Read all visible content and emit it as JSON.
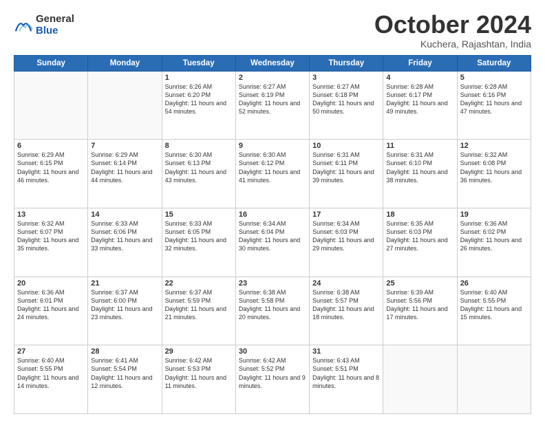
{
  "logo": {
    "general": "General",
    "blue": "Blue"
  },
  "header": {
    "month": "October 2024",
    "location": "Kuchera, Rajashtan, India"
  },
  "days": [
    "Sunday",
    "Monday",
    "Tuesday",
    "Wednesday",
    "Thursday",
    "Friday",
    "Saturday"
  ],
  "weeks": [
    [
      {
        "day": "",
        "content": ""
      },
      {
        "day": "",
        "content": ""
      },
      {
        "day": "1",
        "content": "Sunrise: 6:26 AM\nSunset: 6:20 PM\nDaylight: 11 hours and 54 minutes."
      },
      {
        "day": "2",
        "content": "Sunrise: 6:27 AM\nSunset: 6:19 PM\nDaylight: 11 hours and 52 minutes."
      },
      {
        "day": "3",
        "content": "Sunrise: 6:27 AM\nSunset: 6:18 PM\nDaylight: 11 hours and 50 minutes."
      },
      {
        "day": "4",
        "content": "Sunrise: 6:28 AM\nSunset: 6:17 PM\nDaylight: 11 hours and 49 minutes."
      },
      {
        "day": "5",
        "content": "Sunrise: 6:28 AM\nSunset: 6:16 PM\nDaylight: 11 hours and 47 minutes."
      }
    ],
    [
      {
        "day": "6",
        "content": "Sunrise: 6:29 AM\nSunset: 6:15 PM\nDaylight: 11 hours and 46 minutes."
      },
      {
        "day": "7",
        "content": "Sunrise: 6:29 AM\nSunset: 6:14 PM\nDaylight: 11 hours and 44 minutes."
      },
      {
        "day": "8",
        "content": "Sunrise: 6:30 AM\nSunset: 6:13 PM\nDaylight: 11 hours and 43 minutes."
      },
      {
        "day": "9",
        "content": "Sunrise: 6:30 AM\nSunset: 6:12 PM\nDaylight: 11 hours and 41 minutes."
      },
      {
        "day": "10",
        "content": "Sunrise: 6:31 AM\nSunset: 6:11 PM\nDaylight: 11 hours and 39 minutes."
      },
      {
        "day": "11",
        "content": "Sunrise: 6:31 AM\nSunset: 6:10 PM\nDaylight: 11 hours and 38 minutes."
      },
      {
        "day": "12",
        "content": "Sunrise: 6:32 AM\nSunset: 6:08 PM\nDaylight: 11 hours and 36 minutes."
      }
    ],
    [
      {
        "day": "13",
        "content": "Sunrise: 6:32 AM\nSunset: 6:07 PM\nDaylight: 11 hours and 35 minutes."
      },
      {
        "day": "14",
        "content": "Sunrise: 6:33 AM\nSunset: 6:06 PM\nDaylight: 11 hours and 33 minutes."
      },
      {
        "day": "15",
        "content": "Sunrise: 6:33 AM\nSunset: 6:05 PM\nDaylight: 11 hours and 32 minutes."
      },
      {
        "day": "16",
        "content": "Sunrise: 6:34 AM\nSunset: 6:04 PM\nDaylight: 11 hours and 30 minutes."
      },
      {
        "day": "17",
        "content": "Sunrise: 6:34 AM\nSunset: 6:03 PM\nDaylight: 11 hours and 29 minutes."
      },
      {
        "day": "18",
        "content": "Sunrise: 6:35 AM\nSunset: 6:03 PM\nDaylight: 11 hours and 27 minutes."
      },
      {
        "day": "19",
        "content": "Sunrise: 6:36 AM\nSunset: 6:02 PM\nDaylight: 11 hours and 26 minutes."
      }
    ],
    [
      {
        "day": "20",
        "content": "Sunrise: 6:36 AM\nSunset: 6:01 PM\nDaylight: 11 hours and 24 minutes."
      },
      {
        "day": "21",
        "content": "Sunrise: 6:37 AM\nSunset: 6:00 PM\nDaylight: 11 hours and 23 minutes."
      },
      {
        "day": "22",
        "content": "Sunrise: 6:37 AM\nSunset: 5:59 PM\nDaylight: 11 hours and 21 minutes."
      },
      {
        "day": "23",
        "content": "Sunrise: 6:38 AM\nSunset: 5:58 PM\nDaylight: 11 hours and 20 minutes."
      },
      {
        "day": "24",
        "content": "Sunrise: 6:38 AM\nSunset: 5:57 PM\nDaylight: 11 hours and 18 minutes."
      },
      {
        "day": "25",
        "content": "Sunrise: 6:39 AM\nSunset: 5:56 PM\nDaylight: 11 hours and 17 minutes."
      },
      {
        "day": "26",
        "content": "Sunrise: 6:40 AM\nSunset: 5:55 PM\nDaylight: 11 hours and 15 minutes."
      }
    ],
    [
      {
        "day": "27",
        "content": "Sunrise: 6:40 AM\nSunset: 5:55 PM\nDaylight: 11 hours and 14 minutes."
      },
      {
        "day": "28",
        "content": "Sunrise: 6:41 AM\nSunset: 5:54 PM\nDaylight: 11 hours and 12 minutes."
      },
      {
        "day": "29",
        "content": "Sunrise: 6:42 AM\nSunset: 5:53 PM\nDaylight: 11 hours and 11 minutes."
      },
      {
        "day": "30",
        "content": "Sunrise: 6:42 AM\nSunset: 5:52 PM\nDaylight: 11 hours and 9 minutes."
      },
      {
        "day": "31",
        "content": "Sunrise: 6:43 AM\nSunset: 5:51 PM\nDaylight: 11 hours and 8 minutes."
      },
      {
        "day": "",
        "content": ""
      },
      {
        "day": "",
        "content": ""
      }
    ]
  ]
}
